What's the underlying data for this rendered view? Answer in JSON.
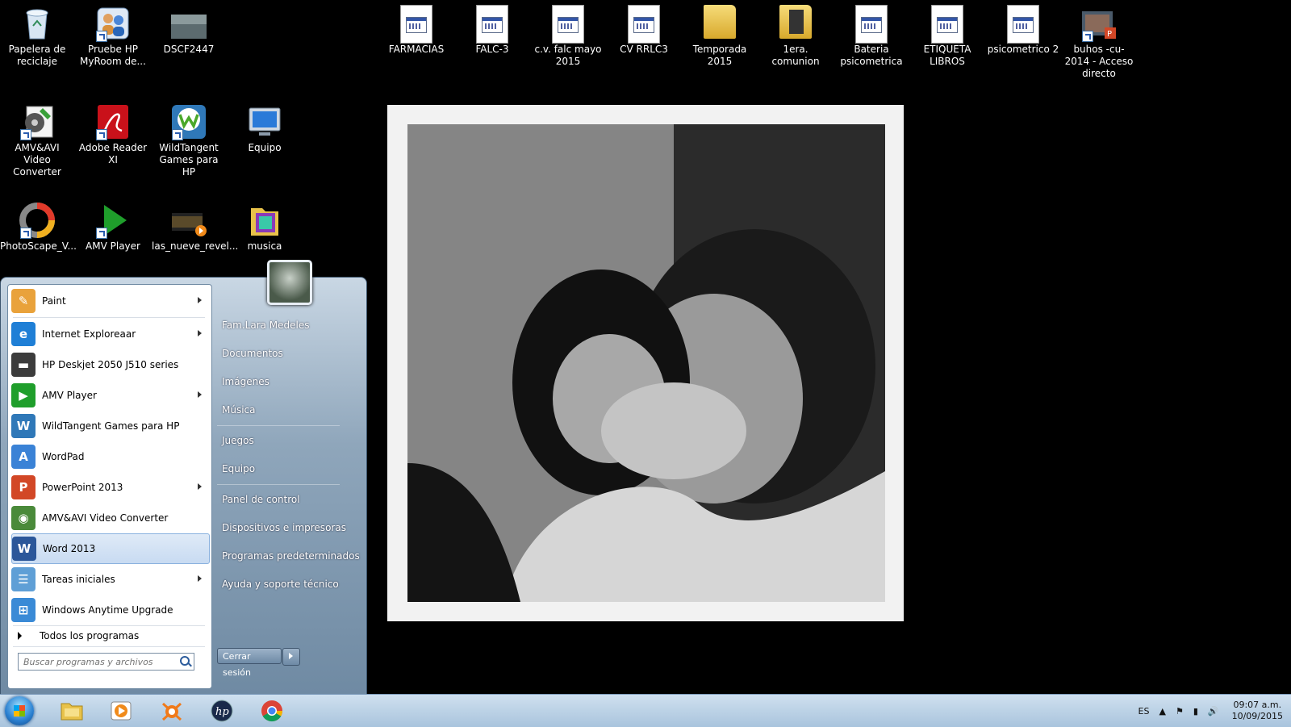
{
  "desktop": {
    "left_icons": [
      {
        "label": "Papelera de reciclaje",
        "icon": "recycle-bin"
      },
      {
        "label": "Pruebe HP MyRoom de...",
        "icon": "hp-myroom"
      },
      {
        "label": "DSCF2447",
        "icon": "photo"
      },
      {
        "label": "AMV&AVI Video Converter",
        "icon": "video-converter"
      },
      {
        "label": "Adobe Reader XI",
        "icon": "adobe-reader"
      },
      {
        "label": "WildTangent Games para HP",
        "icon": "wildtangent"
      },
      {
        "label": "Equipo",
        "icon": "computer"
      },
      {
        "label": "PhotoScape_V...",
        "icon": "photoscape"
      },
      {
        "label": "AMV Player",
        "icon": "amv-player"
      },
      {
        "label": "las_nueve_revel...",
        "icon": "video-file"
      },
      {
        "label": "musica",
        "icon": "folder-music"
      }
    ],
    "top_icons": [
      {
        "label": "FARMACIAS",
        "icon": "document"
      },
      {
        "label": "FALC-3",
        "icon": "document"
      },
      {
        "label": "c.v. falc mayo 2015",
        "icon": "document"
      },
      {
        "label": "CV RRLC3",
        "icon": "document"
      },
      {
        "label": "Temporada 2015",
        "icon": "folder"
      },
      {
        "label": "1era. comunion",
        "icon": "folder"
      },
      {
        "label": "Bateria psicometrica",
        "icon": "document"
      },
      {
        "label": "ETIQUETA LIBROS",
        "icon": "document"
      },
      {
        "label": "psicometrico 2",
        "icon": "document"
      },
      {
        "label": "buhos -cu-2014 - Acceso directo",
        "icon": "powerpoint-shortcut"
      }
    ]
  },
  "start_menu": {
    "programs": [
      {
        "label": "Paint",
        "icon": "paint-icon",
        "color": "#e9a23b",
        "arrow": true
      },
      {
        "label": "Internet Exploreaar",
        "icon": "ie-icon",
        "color": "#1f7fd6",
        "arrow": true
      },
      {
        "label": "HP Deskjet 2050 J510 series",
        "icon": "printer-icon",
        "color": "#3c3c3c",
        "arrow": false
      },
      {
        "label": "AMV Player",
        "icon": "amv-player-icon",
        "color": "#1f9e2b",
        "arrow": true
      },
      {
        "label": "WildTangent Games para HP",
        "icon": "wildtangent-icon",
        "color": "#2f78b8",
        "arrow": false
      },
      {
        "label": "WordPad",
        "icon": "wordpad-icon",
        "color": "#3a82d6",
        "arrow": false
      },
      {
        "label": "PowerPoint 2013",
        "icon": "powerpoint-icon",
        "color": "#d24726",
        "arrow": true
      },
      {
        "label": "AMV&AVI Video Converter",
        "icon": "converter-icon",
        "color": "#4a8a3a",
        "arrow": false
      },
      {
        "label": "Word 2013",
        "icon": "word-icon",
        "color": "#2b579a",
        "arrow": false,
        "selected": true
      },
      {
        "label": "Tareas iniciales",
        "icon": "tasks-icon",
        "color": "#5f9fd6",
        "arrow": true
      },
      {
        "label": "Windows Anytime Upgrade",
        "icon": "windows-icon",
        "color": "#3a8ad6",
        "arrow": false
      }
    ],
    "all_programs": "Todos los programas",
    "search_placeholder": "Buscar programas y archivos",
    "right_links": [
      "Fam.Lara Medeles",
      "Documentos",
      "Imágenes",
      "Música",
      "Juegos",
      "Equipo",
      "Panel de control",
      "Dispositivos e impresoras",
      "Programas predeterminados",
      "Ayuda y soporte técnico"
    ],
    "shutdown_label": "Cerrar sesión"
  },
  "taskbar": {
    "pinned": [
      "explorer",
      "media-player",
      "avast",
      "hp",
      "chrome"
    ],
    "language": "ES",
    "time": "09:07 a.m.",
    "date": "10/09/2015"
  }
}
